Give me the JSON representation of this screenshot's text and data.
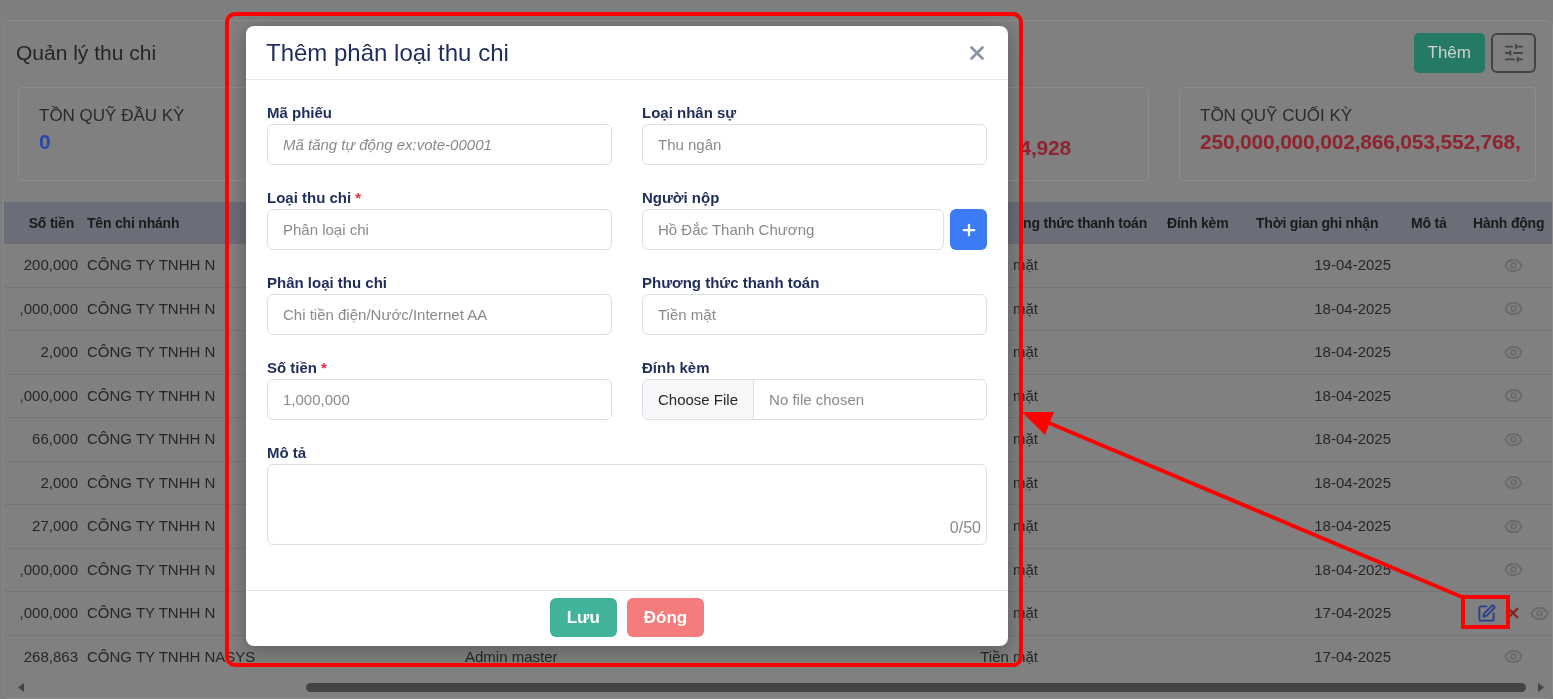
{
  "page": {
    "title": "Quản lý thu chi",
    "add_button": "Thêm"
  },
  "stats": [
    {
      "label": "TỒN QUỸ ĐẦU KỲ",
      "value": "0",
      "color": "#2b47a8"
    },
    {
      "value": "4,928",
      "color": "#8e2430"
    },
    {
      "label": "TỒN QUỸ CUỐI KỲ",
      "value": "250,000,000,002,866,053,552,768,",
      "color": "#8e2430"
    }
  ],
  "table": {
    "headers": {
      "amount": "Số tiền",
      "branch": "Tên chi nhánh",
      "payment_method": "ng thức thanh toán",
      "attachment": "Đính kèm",
      "recorded_time": "Thời gian ghi nhận",
      "description": "Mô tả",
      "actions": "Hành động"
    },
    "rows": [
      {
        "amount": "200,000",
        "branch": "CÔNG TY TNHH N",
        "payment_method": "mặt",
        "recorded_time": "19-04-2025",
        "actions": [
          {
            "kind": "view"
          }
        ]
      },
      {
        "amount": ",000,000",
        "branch": "CÔNG TY TNHH N",
        "payment_method": "mặt",
        "recorded_time": "18-04-2025",
        "actions": [
          {
            "kind": "view"
          }
        ]
      },
      {
        "amount": "2,000",
        "branch": "CÔNG TY TNHH N",
        "payment_method": "mặt",
        "recorded_time": "18-04-2025",
        "actions": [
          {
            "kind": "view"
          }
        ]
      },
      {
        "amount": ",000,000",
        "branch": "CÔNG TY TNHH N",
        "payment_method": "mặt",
        "recorded_time": "18-04-2025",
        "actions": [
          {
            "kind": "view"
          }
        ]
      },
      {
        "amount": "66,000",
        "branch": "CÔNG TY TNHH N",
        "payment_method": "mặt",
        "recorded_time": "18-04-2025",
        "actions": [
          {
            "kind": "view"
          }
        ]
      },
      {
        "amount": "2,000",
        "branch": "CÔNG TY TNHH N",
        "payment_method": "mặt",
        "recorded_time": "18-04-2025",
        "actions": [
          {
            "kind": "view"
          }
        ]
      },
      {
        "amount": "27,000",
        "branch": "CÔNG TY TNHH N",
        "payment_method": "mặt",
        "recorded_time": "18-04-2025",
        "actions": [
          {
            "kind": "view"
          }
        ]
      },
      {
        "amount": ",000,000",
        "branch": "CÔNG TY TNHH N",
        "payment_method": "mặt",
        "recorded_time": "18-04-2025",
        "actions": [
          {
            "kind": "view"
          }
        ]
      },
      {
        "amount": ",000,000",
        "branch": "CÔNG TY TNHH N",
        "payment_method": "mặt",
        "recorded_time": "17-04-2025",
        "actions": [
          {
            "kind": "edit"
          },
          {
            "kind": "delete"
          },
          {
            "kind": "view"
          }
        ]
      },
      {
        "amount": "268,863",
        "branch": "CÔNG TY TNHH NASYS",
        "column_3": "Admin master",
        "payment_method": "Tiền mặt",
        "recorded_time": "17-04-2025",
        "actions": [
          {
            "kind": "view"
          }
        ]
      }
    ]
  },
  "modal": {
    "title": "Thêm phân loại thu chi",
    "required_mark": "*",
    "fields": [
      {
        "kind": "text",
        "label": "Mã phiếu",
        "required": false,
        "placeholder": "Mã tăng tự động ex:vote-00001",
        "italic": true
      },
      {
        "kind": "text",
        "label": "Loại nhân sự",
        "required": false,
        "placeholder": "Thu ngân",
        "italic": false
      },
      {
        "kind": "text",
        "label": "Loại thu chi",
        "required": true,
        "placeholder": "Phân loại chi",
        "italic": false
      },
      {
        "kind": "add",
        "label": "Người nộp",
        "required": false,
        "placeholder": "Hồ Đắc Thanh Chương",
        "italic": false
      },
      {
        "kind": "text",
        "label": "Phân loại thu chi",
        "required": false,
        "placeholder": "Chi tiền điện/Nước/Internet AA",
        "italic": false
      },
      {
        "kind": "text",
        "label": "Phương thức thanh toán",
        "required": false,
        "placeholder": "Tiền mặt",
        "italic": false
      },
      {
        "kind": "text",
        "label": "Số tiền",
        "required": true,
        "placeholder": "1,000,000",
        "italic": false
      },
      {
        "kind": "file",
        "label": "Đính kèm",
        "required": false,
        "button": "Choose File",
        "status": "No file chosen"
      },
      {
        "kind": "textarea",
        "label": "Mô tả",
        "required": false,
        "counter": "0/50"
      }
    ],
    "buttons": [
      {
        "kind": "save",
        "label": "Lưu"
      },
      {
        "kind": "close",
        "label": "Đóng"
      }
    ]
  }
}
